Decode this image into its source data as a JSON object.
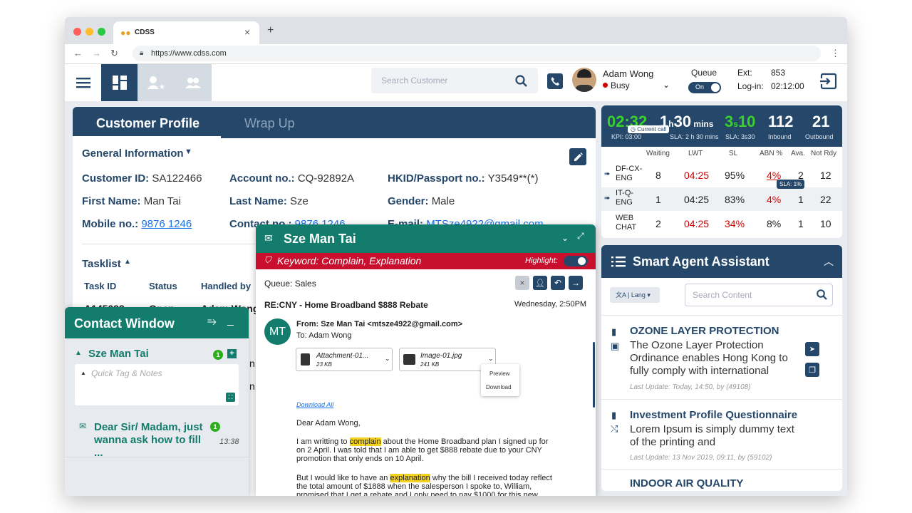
{
  "browser": {
    "tab_title": "CDSS",
    "url": "https://www.cdss.com"
  },
  "header": {
    "search_placeholder": "Search Customer",
    "agent_name": "Adam Wong",
    "agent_status": "Busy",
    "queue_label": "Queue",
    "queue_toggle": "On",
    "ext_label": "Ext:",
    "ext_value": "853",
    "login_label": "Log-in:",
    "login_value": "02:12:00"
  },
  "customer_profile": {
    "tabs": [
      "Customer Profile",
      "Wrap Up"
    ],
    "section_title": "General Information",
    "fields": {
      "customer_id_label": "Customer ID:",
      "customer_id": "SA122466",
      "account_label": "Account no.:",
      "account": "CQ-92892A",
      "hkid_label": "HKID/Passport no.:",
      "hkid": "Y3549**(*)",
      "first_name_label": "First Name:",
      "first_name": "Man Tai",
      "last_name_label": "Last Name:",
      "last_name": "Sze",
      "gender_label": "Gender:",
      "gender": "Male",
      "mobile_label": "Mobile no.:",
      "mobile": "9876 1246",
      "contact_label": "Contact no.:",
      "contact": "9876 1246",
      "email_label": "E-mail:",
      "email": "MTSze4922@gmail.com"
    },
    "tasklist": {
      "title": "Tasklist",
      "columns": [
        "Task ID",
        "Status",
        "Handled by"
      ],
      "first_row": [
        "A145093",
        "Open",
        "Adam Wong"
      ]
    }
  },
  "stats": {
    "current_time": "02:32",
    "current_call_badge": "Current call",
    "kpi": "KPI: 03:00",
    "lwt_value": "1",
    "lwt_unit": "h",
    "lwt_value2": "30",
    "lwt_unit2": "mins",
    "lwt_sub": "SLA: 2 h 30 mins",
    "sl_value": "3",
    "sl_unit": "s",
    "sl_value2": "10",
    "sl_sub": "SLA: 3s30",
    "inbound_value": "112",
    "inbound_label": "Inbound",
    "outbound_value": "21",
    "outbound_label": "Outbound",
    "columns": [
      "Waiting",
      "LWT",
      "SL",
      "ABN %",
      "Ava.",
      "Not Rdy"
    ],
    "rows": [
      {
        "queue": "DF-CX-ENG",
        "waiting": "8",
        "lwt": "04:25",
        "sl": "95%",
        "abn": "4%",
        "ava": "2",
        "not_rdy": "12"
      },
      {
        "queue": "IT-Q-ENG",
        "waiting": "1",
        "lwt": "04:25",
        "sl": "83%",
        "abn": "4%",
        "ava": "1",
        "not_rdy": "22"
      },
      {
        "queue": "WEB CHAT",
        "waiting": "2",
        "lwt": "04:25",
        "sl": "34%",
        "abn": "8%",
        "ava": "1",
        "not_rdy": "10"
      }
    ],
    "sla_tooltip": "SLA: 1%"
  },
  "assistant": {
    "title": "Smart Agent Assistant",
    "lang_label": "Lang",
    "search_placeholder": "Search Content",
    "articles": [
      {
        "title": "OZONE LAYER PROTECTION",
        "body": "The Ozone Layer Protection Ordinance enables Hong Kong to fully comply with international",
        "meta": "Last Update: Today, 14:50, by (49108)"
      },
      {
        "title": "Investment Profile Questionnaire",
        "body": "Lorem Ipsum is simply dummy text of the printing and",
        "meta": "Last Update: 13 Nov 2019, 09:11,  by (59102)"
      },
      {
        "title": "INDOOR AIR QUALITY",
        "body": "",
        "meta": ""
      }
    ]
  },
  "email": {
    "sender_title": "Sze Man Tai",
    "keyword": "Keyword: Complain, Explanation",
    "highlight_label": "Highlight:",
    "queue": "Queue: Sales",
    "subject": "RE:CNY - Home Broadband $888 Rebate",
    "date": "Wednesday, 2:50PM",
    "avatar": "MT",
    "from": "From: Sze Man Tai <mtsze4922@gmail.com>",
    "to": "To: Adam Wong",
    "attachments": [
      {
        "name": "Attachment-01...",
        "size": "23 KB"
      },
      {
        "name": "Image-01.jpg",
        "size": "241 KB"
      }
    ],
    "menu": [
      "Preview",
      "Download"
    ],
    "download_all": "Download All",
    "greeting": "Dear Adam Wong,",
    "p1_pre": "I am writting to ",
    "p1_hl": "complain",
    "p1_post": " about the Home Broadband plan I signed up for on 2 April. I was told that I am able to get $888 rebate due to your CNY promotion that only ends on 10 April.",
    "p2_pre": "But I would like to have an ",
    "p2_hl": "explanation",
    "p2_post": " why the bill I received today reflect the total amount of $1888 when the salesperson I spoke to, William, promised that I get a rebate and I only need to pay $1000 for this new Home Broadband plan I signed up for. Please find the"
  },
  "contact_window": {
    "title": "Contact Window",
    "contact_name": "Sze Man Tai",
    "contact_badge": "1",
    "notes_placeholder": "Quick Tag & Notes",
    "message": "Dear Sir/ Madam, just wanna ask how to fill ...",
    "message_badge": "1",
    "message_time": "13:38"
  },
  "colors": {
    "navy": "#25476a",
    "teal": "#137c6c",
    "red": "#c8102e",
    "green": "#2bb01b",
    "highlight": "#f4d21d"
  }
}
